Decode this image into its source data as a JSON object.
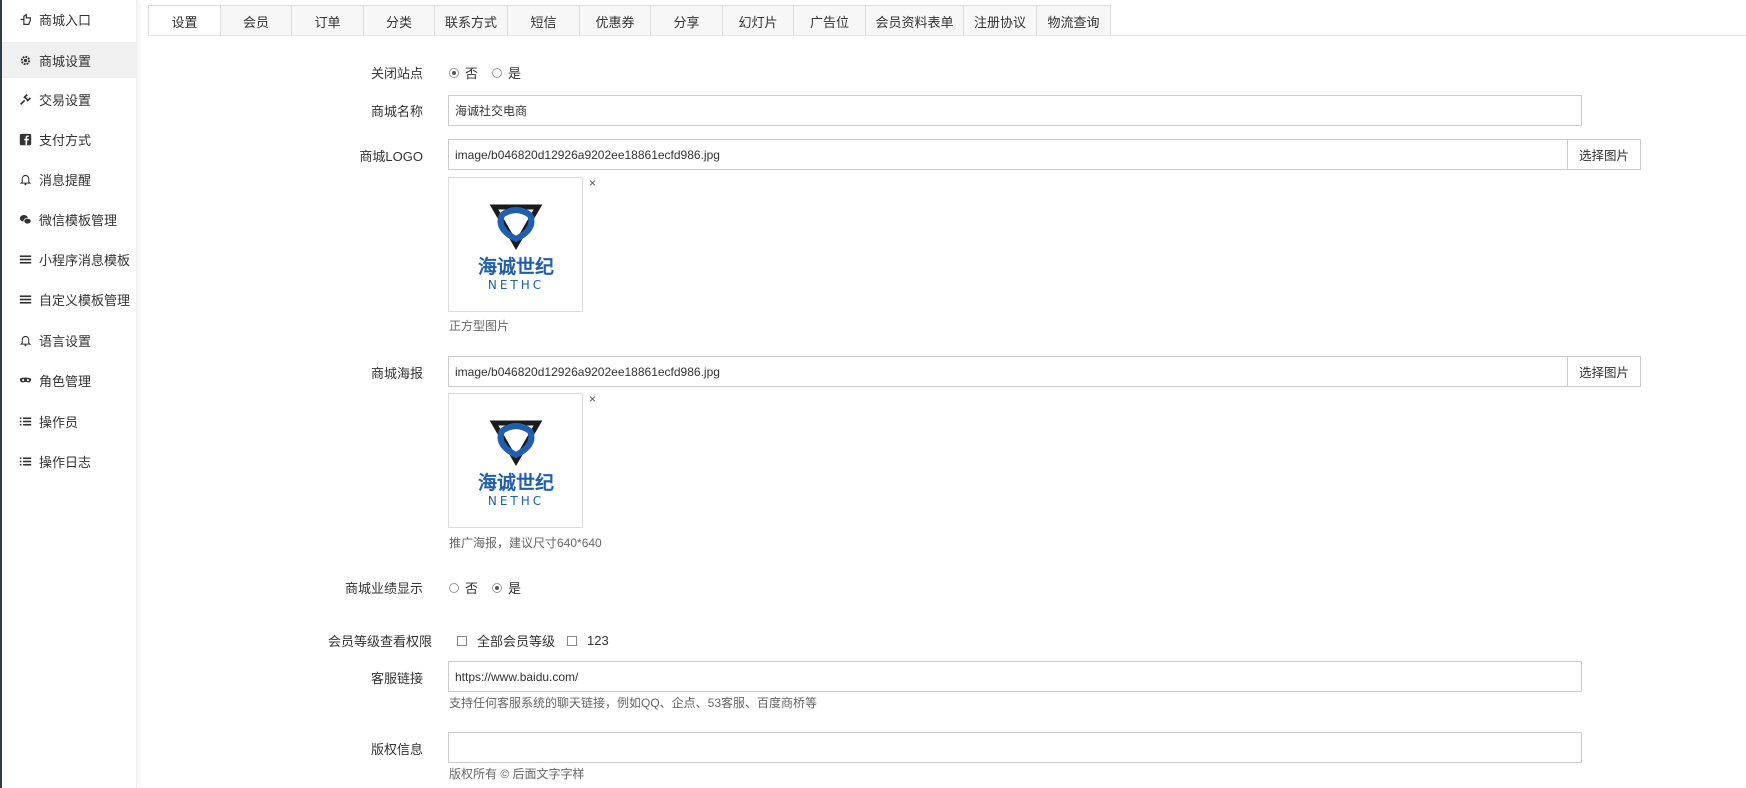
{
  "sidebar": {
    "items": [
      {
        "label": "商城入口",
        "icon": "hand-point-icon"
      },
      {
        "label": "商城设置",
        "icon": "gear-icon"
      },
      {
        "label": "交易设置",
        "icon": "plug-icon"
      },
      {
        "label": "支付方式",
        "icon": "facebook-square-icon"
      },
      {
        "label": "消息提醒",
        "icon": "bell-icon"
      },
      {
        "label": "微信模板管理",
        "icon": "wechat-icon"
      },
      {
        "label": "小程序消息模板",
        "icon": "bars-icon"
      },
      {
        "label": "自定义模板管理",
        "icon": "bars-icon"
      },
      {
        "label": "语言设置",
        "icon": "bell-icon"
      },
      {
        "label": "角色管理",
        "icon": "mask-icon"
      },
      {
        "label": "操作员",
        "icon": "list-icon"
      },
      {
        "label": "操作日志",
        "icon": "list-icon"
      }
    ],
    "active_index": 1
  },
  "tabs": [
    "设置",
    "会员",
    "订单",
    "分类",
    "联系方式",
    "短信",
    "优惠券",
    "分享",
    "幻灯片",
    "广告位",
    "会员资料表单",
    "注册协议",
    "物流查询"
  ],
  "form": {
    "close_site": {
      "label": "关闭站点",
      "options": [
        "否",
        "是"
      ],
      "selected": "否"
    },
    "shop_name": {
      "label": "商城名称",
      "value": "海诚社交电商"
    },
    "shop_logo": {
      "label": "商城LOGO",
      "value": "image/b046820d12926a9202ee18861ecfd986.jpg",
      "button": "选择图片",
      "close": "×",
      "help": "正方型图片"
    },
    "shop_poster": {
      "label": "商城海报",
      "value": "image/b046820d12926a9202ee18861ecfd986.jpg",
      "button": "选择图片",
      "close": "×",
      "help": "推广海报，建议尺寸640*640"
    },
    "show_performance": {
      "label": "商城业绩显示",
      "options": [
        "否",
        "是"
      ],
      "selected": "是"
    },
    "member_level": {
      "label": "会员等级查看权限",
      "options": [
        "全部会员等级",
        "123"
      ]
    },
    "service_link": {
      "label": "客服链接",
      "value": "https://www.baidu.com/",
      "help": "支持任何客服系统的聊天链接，例如QQ、企点、53客服、百度商桥等"
    },
    "copyright": {
      "label": "版权信息",
      "value": "",
      "help": "版权所有 © 后面文字字样"
    }
  },
  "logo_image": {
    "brand_cn": "海诚世纪",
    "brand_en": "NETHC",
    "colors": {
      "blue": "#1f5fae",
      "dark": "#1a1a1a"
    }
  }
}
